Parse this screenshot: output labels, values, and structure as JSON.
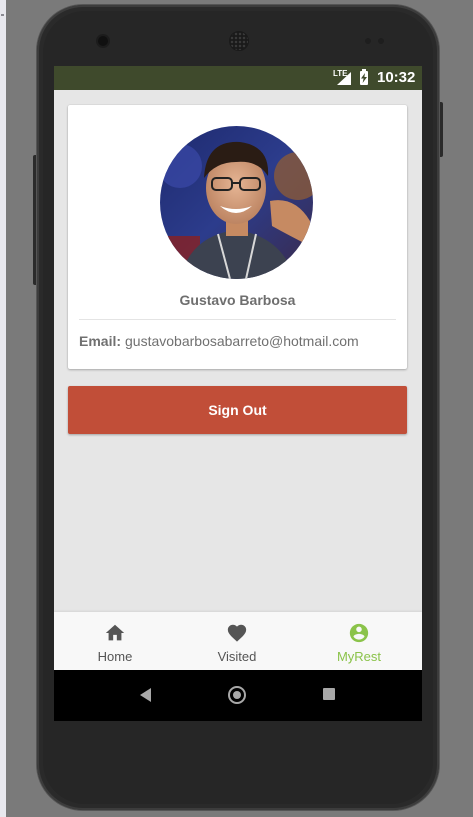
{
  "status_bar": {
    "network": "LTE",
    "time": "10:32"
  },
  "profile": {
    "name": "Gustavo Barbosa",
    "email_label": "Email:",
    "email": "gustavobarbosabarreto@hotmail.com"
  },
  "actions": {
    "sign_out_label": "Sign Out"
  },
  "bottom_nav": {
    "items": [
      {
        "label": "Home",
        "icon": "home-icon"
      },
      {
        "label": "Visited",
        "icon": "heart-icon"
      },
      {
        "label": "MyRest",
        "icon": "account-circle-icon"
      }
    ],
    "active": "MyRest",
    "active_color": "#8bc34a"
  },
  "colors": {
    "status_bar": "#3f4a2c",
    "sign_out_button": "#c14e38",
    "screen_background": "#e6e6e6"
  }
}
